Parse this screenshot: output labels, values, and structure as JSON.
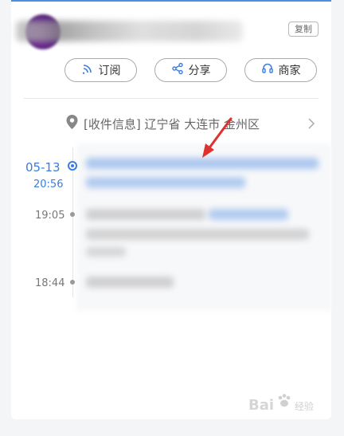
{
  "header": {
    "copy_label": "复制"
  },
  "actions": [
    {
      "label": "订阅",
      "icon": "rss-icon"
    },
    {
      "label": "分享",
      "icon": "share-icon"
    },
    {
      "label": "商家",
      "icon": "headset-icon"
    }
  ],
  "address": {
    "text": "[收件信息] 辽宁省 大连市 金州区",
    "icon": "location-pin-icon"
  },
  "timeline": [
    {
      "date": "05-13",
      "time": "20:56",
      "active": true
    },
    {
      "time": "19:05",
      "active": false
    },
    {
      "time": "18:44",
      "active": false
    }
  ],
  "colors": {
    "accent": "#3b7ddd",
    "annotation_arrow": "#e0312f"
  },
  "watermark": {
    "brand": "Bai",
    "sub": "经验",
    "icon": "paw-icon"
  }
}
